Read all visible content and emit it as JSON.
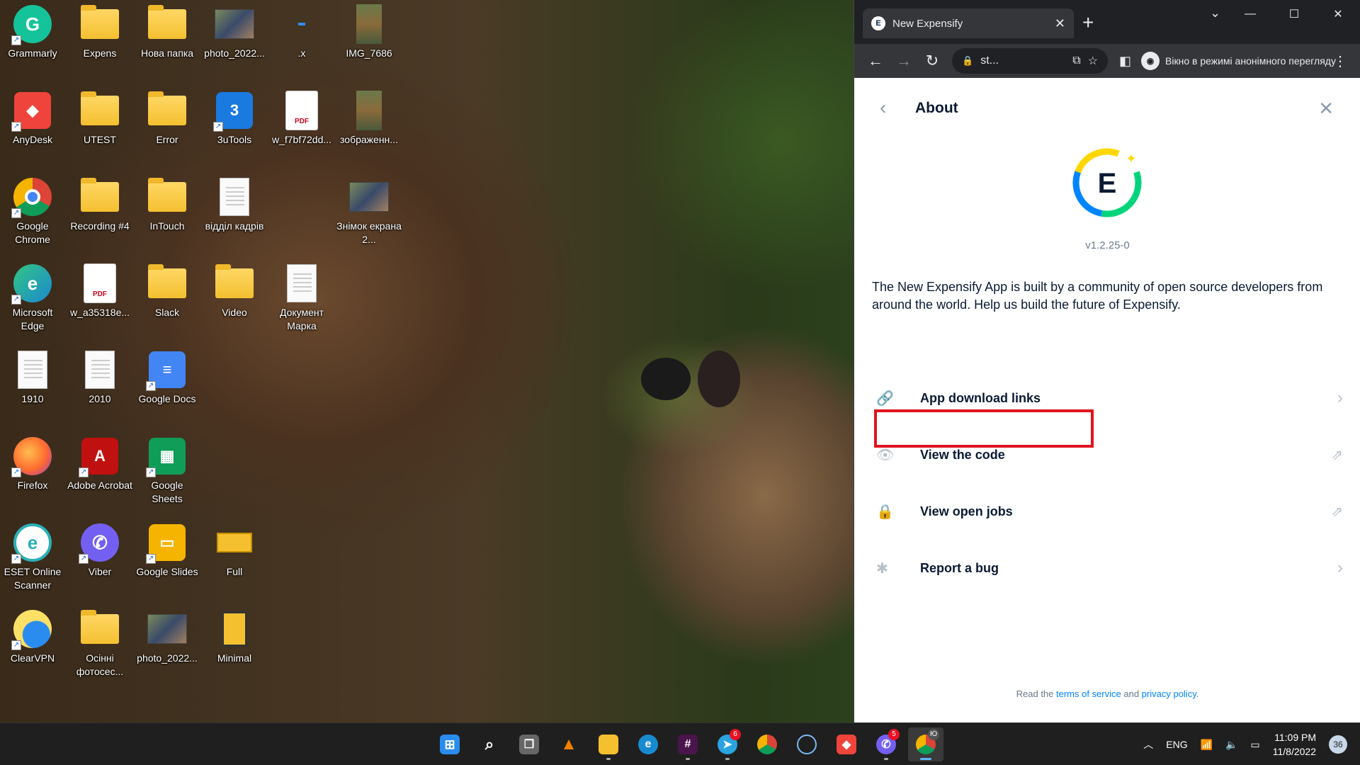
{
  "desktop": {
    "icons": [
      {
        "label": "Grammarly",
        "kind": "grammarly"
      },
      {
        "label": "Expens",
        "kind": "folder"
      },
      {
        "label": "Нова папка",
        "kind": "folder"
      },
      {
        "label": "photo_2022...",
        "kind": "photo"
      },
      {
        "label": ".x",
        "kind": "blank"
      },
      {
        "label": "IMG_7686",
        "kind": "photo-tall"
      },
      {
        "label": "AnyDesk",
        "kind": "anydesk"
      },
      {
        "label": "UTEST",
        "kind": "folder"
      },
      {
        "label": "Error",
        "kind": "folder"
      },
      {
        "label": "3uTools",
        "kind": "3utools"
      },
      {
        "label": "w_f7bf72dd...",
        "kind": "pdf"
      },
      {
        "label": "зображенн...",
        "kind": "photo-tall"
      },
      {
        "label": "Google Chrome",
        "kind": "chrome"
      },
      {
        "label": "Recording #4",
        "kind": "folder"
      },
      {
        "label": "InTouch",
        "kind": "folder"
      },
      {
        "label": "відділ кадрів",
        "kind": "doc"
      },
      {
        "label": "Знімок екрана 2...",
        "kind": "photo"
      },
      {
        "label": "Microsoft Edge",
        "kind": "edge"
      },
      {
        "label": "w_a35318e...",
        "kind": "pdf"
      },
      {
        "label": "Slack",
        "kind": "folder"
      },
      {
        "label": "Video",
        "kind": "folder"
      },
      {
        "label": "Документ Марка",
        "kind": "doc"
      },
      {
        "label": "1910",
        "kind": "doc"
      },
      {
        "label": "2010",
        "kind": "doc"
      },
      {
        "label": "Google Docs",
        "kind": "gdocs"
      },
      {
        "label": "Firefox",
        "kind": "firefox"
      },
      {
        "label": "Adobe Acrobat",
        "kind": "acrobat"
      },
      {
        "label": "Google Sheets",
        "kind": "gsheets"
      },
      {
        "label": "ESET Online Scanner",
        "kind": "eset"
      },
      {
        "label": "Viber",
        "kind": "viber"
      },
      {
        "label": "Google Slides",
        "kind": "gslides"
      },
      {
        "label": "Full",
        "kind": "full"
      },
      {
        "label": "ClearVPN",
        "kind": "clearvpn"
      },
      {
        "label": "Осінні фотосес...",
        "kind": "folder"
      },
      {
        "label": "photo_2022...",
        "kind": "photo"
      },
      {
        "label": "Minimal",
        "kind": "minimal"
      }
    ]
  },
  "browser": {
    "tab_title": "New Expensify",
    "tab_favicon": "E",
    "url": "st...",
    "incognito_label": "Вікно в режимі анонімного перегляду"
  },
  "page": {
    "title": "About",
    "version": "v1.2.25-0",
    "about_text": "The New Expensify App is built by a community of open source developers from around the world. Help us build the future of Expensify.",
    "menu": [
      {
        "label": "App download links",
        "icon": "link-icon",
        "arrow": "chevron"
      },
      {
        "label": "View the code",
        "icon": "eye-icon",
        "arrow": "external"
      },
      {
        "label": "View open jobs",
        "icon": "lock-icon",
        "arrow": "external"
      },
      {
        "label": "Report a bug",
        "icon": "bug-icon",
        "arrow": "chevron"
      }
    ],
    "footer_prefix": "Read the ",
    "footer_terms": "terms of service",
    "footer_and": " and ",
    "footer_privacy": "privacy policy",
    "footer_suffix": "."
  },
  "taskbar": {
    "badges": {
      "telegram": "6",
      "viber": "5",
      "chrome_profile": "Ю"
    },
    "language": "ENG",
    "time": "11:09 PM",
    "date": "11/8/2022",
    "notification_count": "36"
  },
  "colors": {
    "expensify_dark": "#0b1b34",
    "expensify_link": "#0185ff",
    "highlight_red": "#e0141e",
    "logo_green": "#03d47c",
    "logo_yellow": "#ffd700",
    "logo_blue": "#0185ff"
  }
}
